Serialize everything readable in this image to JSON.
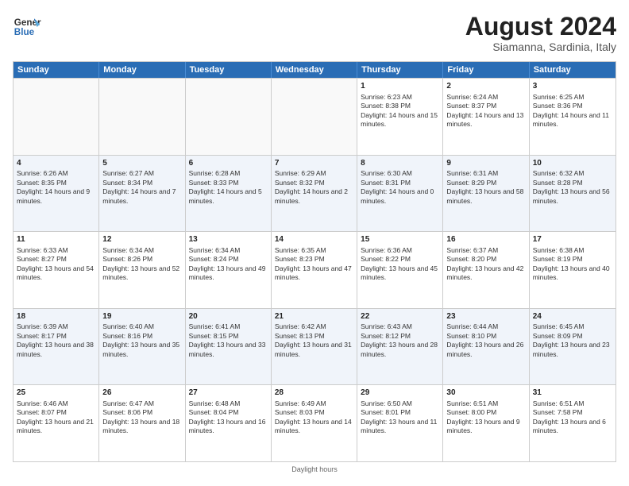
{
  "logo": {
    "line1": "General",
    "line2": "Blue"
  },
  "title": "August 2024",
  "subtitle": "Siamanna, Sardinia, Italy",
  "header_days": [
    "Sunday",
    "Monday",
    "Tuesday",
    "Wednesday",
    "Thursday",
    "Friday",
    "Saturday"
  ],
  "footer": "Daylight hours",
  "weeks": [
    [
      {
        "day": "",
        "info": ""
      },
      {
        "day": "",
        "info": ""
      },
      {
        "day": "",
        "info": ""
      },
      {
        "day": "",
        "info": ""
      },
      {
        "day": "1",
        "info": "Sunrise: 6:23 AM\nSunset: 8:38 PM\nDaylight: 14 hours and 15 minutes."
      },
      {
        "day": "2",
        "info": "Sunrise: 6:24 AM\nSunset: 8:37 PM\nDaylight: 14 hours and 13 minutes."
      },
      {
        "day": "3",
        "info": "Sunrise: 6:25 AM\nSunset: 8:36 PM\nDaylight: 14 hours and 11 minutes."
      }
    ],
    [
      {
        "day": "4",
        "info": "Sunrise: 6:26 AM\nSunset: 8:35 PM\nDaylight: 14 hours and 9 minutes."
      },
      {
        "day": "5",
        "info": "Sunrise: 6:27 AM\nSunset: 8:34 PM\nDaylight: 14 hours and 7 minutes."
      },
      {
        "day": "6",
        "info": "Sunrise: 6:28 AM\nSunset: 8:33 PM\nDaylight: 14 hours and 5 minutes."
      },
      {
        "day": "7",
        "info": "Sunrise: 6:29 AM\nSunset: 8:32 PM\nDaylight: 14 hours and 2 minutes."
      },
      {
        "day": "8",
        "info": "Sunrise: 6:30 AM\nSunset: 8:31 PM\nDaylight: 14 hours and 0 minutes."
      },
      {
        "day": "9",
        "info": "Sunrise: 6:31 AM\nSunset: 8:29 PM\nDaylight: 13 hours and 58 minutes."
      },
      {
        "day": "10",
        "info": "Sunrise: 6:32 AM\nSunset: 8:28 PM\nDaylight: 13 hours and 56 minutes."
      }
    ],
    [
      {
        "day": "11",
        "info": "Sunrise: 6:33 AM\nSunset: 8:27 PM\nDaylight: 13 hours and 54 minutes."
      },
      {
        "day": "12",
        "info": "Sunrise: 6:34 AM\nSunset: 8:26 PM\nDaylight: 13 hours and 52 minutes."
      },
      {
        "day": "13",
        "info": "Sunrise: 6:34 AM\nSunset: 8:24 PM\nDaylight: 13 hours and 49 minutes."
      },
      {
        "day": "14",
        "info": "Sunrise: 6:35 AM\nSunset: 8:23 PM\nDaylight: 13 hours and 47 minutes."
      },
      {
        "day": "15",
        "info": "Sunrise: 6:36 AM\nSunset: 8:22 PM\nDaylight: 13 hours and 45 minutes."
      },
      {
        "day": "16",
        "info": "Sunrise: 6:37 AM\nSunset: 8:20 PM\nDaylight: 13 hours and 42 minutes."
      },
      {
        "day": "17",
        "info": "Sunrise: 6:38 AM\nSunset: 8:19 PM\nDaylight: 13 hours and 40 minutes."
      }
    ],
    [
      {
        "day": "18",
        "info": "Sunrise: 6:39 AM\nSunset: 8:17 PM\nDaylight: 13 hours and 38 minutes."
      },
      {
        "day": "19",
        "info": "Sunrise: 6:40 AM\nSunset: 8:16 PM\nDaylight: 13 hours and 35 minutes."
      },
      {
        "day": "20",
        "info": "Sunrise: 6:41 AM\nSunset: 8:15 PM\nDaylight: 13 hours and 33 minutes."
      },
      {
        "day": "21",
        "info": "Sunrise: 6:42 AM\nSunset: 8:13 PM\nDaylight: 13 hours and 31 minutes."
      },
      {
        "day": "22",
        "info": "Sunrise: 6:43 AM\nSunset: 8:12 PM\nDaylight: 13 hours and 28 minutes."
      },
      {
        "day": "23",
        "info": "Sunrise: 6:44 AM\nSunset: 8:10 PM\nDaylight: 13 hours and 26 minutes."
      },
      {
        "day": "24",
        "info": "Sunrise: 6:45 AM\nSunset: 8:09 PM\nDaylight: 13 hours and 23 minutes."
      }
    ],
    [
      {
        "day": "25",
        "info": "Sunrise: 6:46 AM\nSunset: 8:07 PM\nDaylight: 13 hours and 21 minutes."
      },
      {
        "day": "26",
        "info": "Sunrise: 6:47 AM\nSunset: 8:06 PM\nDaylight: 13 hours and 18 minutes."
      },
      {
        "day": "27",
        "info": "Sunrise: 6:48 AM\nSunset: 8:04 PM\nDaylight: 13 hours and 16 minutes."
      },
      {
        "day": "28",
        "info": "Sunrise: 6:49 AM\nSunset: 8:03 PM\nDaylight: 13 hours and 14 minutes."
      },
      {
        "day": "29",
        "info": "Sunrise: 6:50 AM\nSunset: 8:01 PM\nDaylight: 13 hours and 11 minutes."
      },
      {
        "day": "30",
        "info": "Sunrise: 6:51 AM\nSunset: 8:00 PM\nDaylight: 13 hours and 9 minutes."
      },
      {
        "day": "31",
        "info": "Sunrise: 6:51 AM\nSunset: 7:58 PM\nDaylight: 13 hours and 6 minutes."
      }
    ]
  ]
}
